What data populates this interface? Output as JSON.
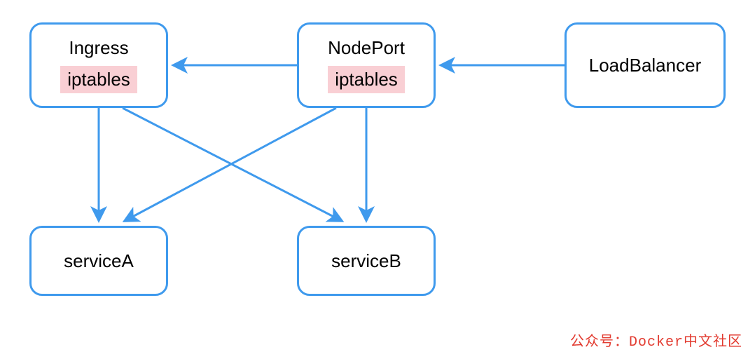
{
  "nodes": {
    "ingress": {
      "title": "Ingress",
      "badge": "iptables"
    },
    "nodeport": {
      "title": "NodePort",
      "badge": "iptables"
    },
    "loadbalancer": {
      "title": "LoadBalancer"
    },
    "serviceA": {
      "label": "serviceA"
    },
    "serviceB": {
      "label": "serviceB"
    }
  },
  "edges": [
    {
      "from": "loadbalancer",
      "to": "nodeport"
    },
    {
      "from": "nodeport",
      "to": "ingress"
    },
    {
      "from": "ingress",
      "to": "serviceA"
    },
    {
      "from": "ingress",
      "to": "serviceB"
    },
    {
      "from": "nodeport",
      "to": "serviceA"
    },
    {
      "from": "nodeport",
      "to": "serviceB"
    }
  ],
  "colors": {
    "stroke": "#3f9aed",
    "badge_bg": "#f9cfd4",
    "footer": "#e23a2f"
  },
  "footer": "公众号：Docker中文社区"
}
